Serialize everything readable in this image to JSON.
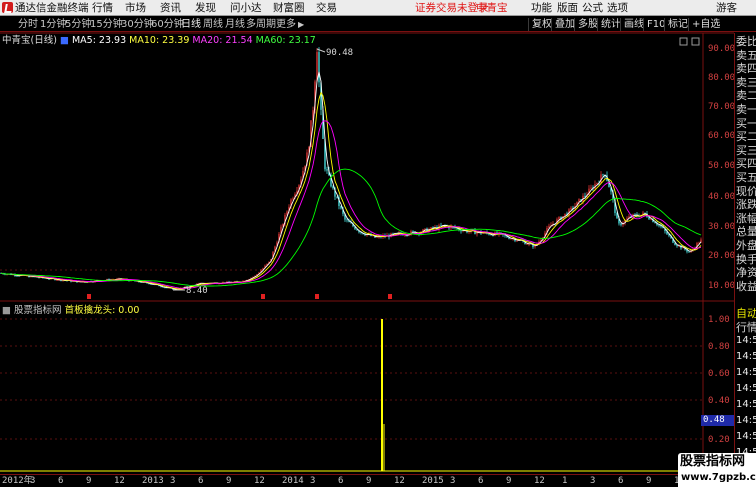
{
  "menubar": {
    "app_title": "通达信金融终端",
    "menus": [
      "行情",
      "市场",
      "资讯",
      "发现",
      "问小达",
      "财富圈",
      "交易"
    ],
    "notice": "证券交易未登录",
    "stock": "中青宝",
    "right": [
      "功能",
      "版面",
      "公式",
      "选项",
      "游客"
    ]
  },
  "toolbar": {
    "periods": [
      "分时",
      "1分钟",
      "5分钟",
      "15分钟",
      "30分钟",
      "60分钟",
      "日线",
      "周线",
      "月线",
      "多周期",
      "更多"
    ],
    "active_period": "日线",
    "more_arrow": "▶",
    "buttons": [
      "复权",
      "叠加",
      "多股",
      "统计",
      "画线",
      "F10",
      "标记",
      "+自选"
    ]
  },
  "main_chart": {
    "stock_label": "中青宝(日线)",
    "ma5_label": "MA5: 23.93",
    "ma10_label": "MA10: 23.39",
    "ma20_label": "MA20: 21.54",
    "ma60_label": "MA60: 23.17",
    "high_label": "90.48",
    "low_label": "8.40",
    "y_ticks": [
      "90.00",
      "80.00",
      "70.00",
      "60.00",
      "50.00",
      "40.00",
      "30.00",
      "20.00",
      "10.00"
    ],
    "colors": {
      "ma5": "#ffffff",
      "ma10": "#ffff00",
      "ma20": "#ff00ff",
      "ma60": "#00ff00",
      "up": "#ff3c3c",
      "down": "#54ffff"
    }
  },
  "indicator": {
    "title": "股票指标网",
    "name": "首板擒龙头: 0.00",
    "y_ticks": [
      "1.00",
      "0.80",
      "0.60",
      "0.40",
      "0.20"
    ],
    "current_value": "0.48"
  },
  "right_panel": {
    "labels": [
      "委比",
      "卖五",
      "卖四",
      "卖三",
      "卖二",
      "卖一",
      "买一",
      "买二",
      "买三",
      "买四",
      "买五",
      "现价",
      "涨跌",
      "涨幅",
      "总量",
      "外盘",
      "换手",
      "净资",
      "收益"
    ],
    "bottom": [
      "自动",
      "行情"
    ],
    "times": [
      "14:50",
      "14:50",
      "14:50",
      "14:50",
      "14:50",
      "14:50",
      "14:50",
      "14:50"
    ]
  },
  "xaxis": {
    "labels": [
      "2012年",
      "3",
      "6",
      "9",
      "12",
      "2013",
      "3",
      "6",
      "9",
      "12",
      "2014",
      "3",
      "6",
      "9",
      "12",
      "2015",
      "3",
      "6",
      "9",
      "12",
      "1",
      "3",
      "6",
      "9",
      "12",
      "1",
      "3",
      "6",
      "9",
      "12"
    ]
  },
  "watermark": {
    "title": "股票指标网",
    "url": "www.7gpzb.com"
  }
}
